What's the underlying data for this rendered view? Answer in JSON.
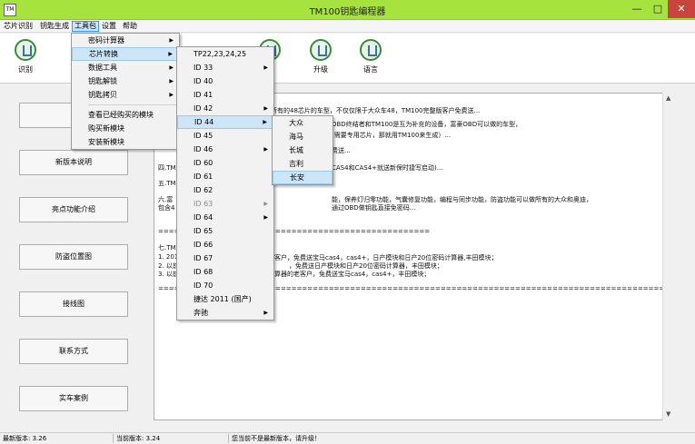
{
  "window": {
    "icon_text": "TM",
    "title": "TM100钥匙编程器",
    "min": "—",
    "max": "□",
    "close": "✕"
  },
  "menubar": [
    "芯片识别",
    "钥匙生成",
    "工具包",
    "设置",
    "帮助"
  ],
  "toolbar": [
    {
      "label": "识别",
      "icon": "identify-icon"
    },
    {
      "label": "",
      "icon": "chip-icon"
    },
    {
      "label": "",
      "icon": "key-icon"
    },
    {
      "label": "",
      "icon": "tools-icon"
    },
    {
      "label": "",
      "icon": "settings-icon"
    },
    {
      "label": "",
      "icon": "help-icon"
    },
    {
      "label": "升级",
      "icon": "upgrade-icon"
    },
    {
      "label": "语言",
      "icon": "language-icon"
    }
  ],
  "sidebar": [
    "",
    "新版本说明",
    "亮点功能介绍",
    "防盗位置图",
    "接线图",
    "联系方式",
    "实车案例"
  ],
  "content_lines": [
    "所有的48芯片的车型，不仅仅限于大众车48，TM100完整版客户免费送...",
    "OBD终结者和TM100是互为补充的设备，富豪OBD可以做的车型，",
    "(需要专用芯片，那就用TM100来生成）...",
    "费送...",
    "四.TM",
    "CAS4和CAS4+就送新保时捷写启动)...",
    "五.TM",
    "六.富",
    "能，保养灯归零功能，气囊修复功能，编程与同步功能，防盗功能可以做所有的大众和奥迪，",
    "包含4",
    "通过OBD做钥匙直接免密码...",
    "===================================================",
    "七.TM",
    "1. 201",
    "的客户，免费送宝马cas4，cas4+，日产模块和日产20位密码计算器,丰田模块；",
    "2. 以前",
    "，免费送日产模块和日产20位密码计算器，丰田模块；",
    "3. 以前",
    "计算器的老客户，免费送宝马cas4，cas4+，丰田模块；",
    "========================================================================================================="
  ],
  "menus": {
    "tools": [
      "密码计算器",
      "芯片转换",
      "数据工具",
      "钥匙解锁",
      "钥匙拷贝",
      "查看已经购买的模块",
      "购买新模块",
      "安装新模块"
    ],
    "chip": [
      "TP22,23,24,25",
      "ID 33",
      "ID 40",
      "ID 41",
      "ID 42",
      "ID 44",
      "ID 45",
      "ID 46",
      "ID 60",
      "ID 61",
      "ID 62",
      "ID 63",
      "ID 64",
      "ID 65",
      "ID 66",
      "ID 67",
      "ID 68",
      "ID 70",
      "捷达 2011 (国产)",
      "奔驰"
    ],
    "id44": [
      "大众",
      "海马",
      "长城",
      "吉利",
      "长安"
    ]
  },
  "status": {
    "latest": "最新版本: 3.26",
    "current": "当前版本: 3.24",
    "message": "您当前不是最新版本，请升级！"
  },
  "scroll": {
    "up": "▲",
    "down": "▼"
  },
  "arrow": "▶"
}
